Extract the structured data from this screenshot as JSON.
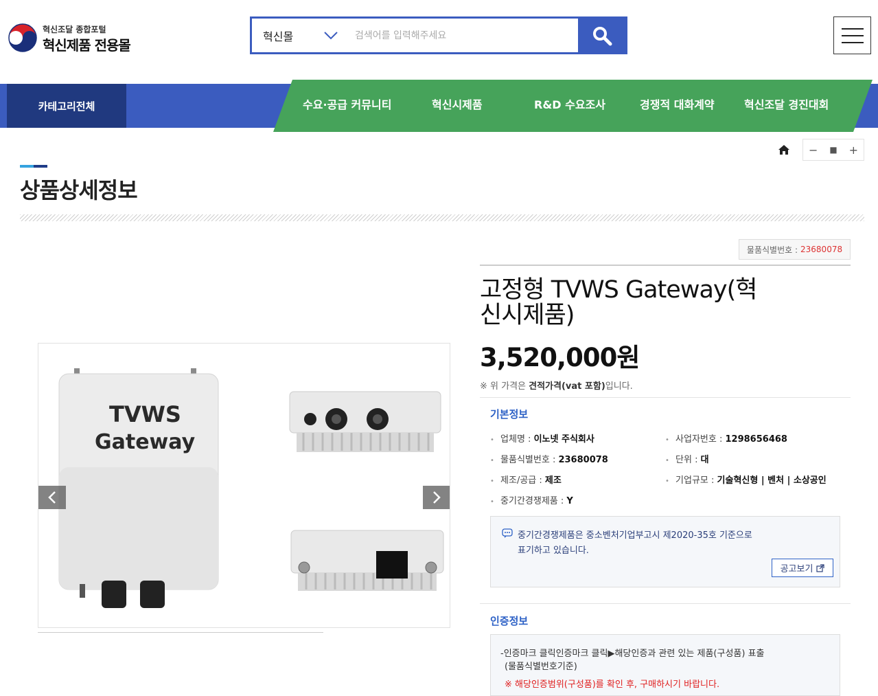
{
  "header": {
    "logo_line1": "혁신조달 종합포털",
    "logo_line2": "혁신제품 전용몰",
    "search": {
      "category": "혁신몰",
      "placeholder": "검색어를 입력해주세요"
    }
  },
  "nav": {
    "all_categories": "카테고리전체",
    "items": [
      "수요·공급 커뮤니티",
      "혁신시제품",
      "R&D 수요조사",
      "경쟁적 대화계약",
      "혁신조달 경진대회"
    ]
  },
  "zoom": {
    "minus": "−",
    "reset": "■",
    "plus": "+"
  },
  "page_title": "상품상세정보",
  "gallery": {
    "main_label_line1": "TVWS",
    "main_label_line2": "Gateway"
  },
  "product": {
    "sku_label": "물품식별번호 :",
    "sku_value": "23680078",
    "name": "고정형 TVWS Gateway(혁신시제품)",
    "price": "3,520,000원",
    "price_note_pre": "※ 위 가격은 ",
    "price_note_bold": "견적가격(vat 포함)",
    "price_note_post": "입니다."
  },
  "basic_info": {
    "title": "기본정보",
    "company_label": "업체명 :",
    "company_value": "이노넷 주식회사",
    "bizno_label": "사업자번호 :",
    "bizno_value": "1298656468",
    "sku_label": "물품식별번호 :",
    "sku_value": "23680078",
    "unit_label": "단위 :",
    "unit_value": "대",
    "supply_label": "제조/공급 :",
    "supply_value": "제조",
    "scale_label": "기업규모 :",
    "scale_value": "기술혁신형 | 벤처 | 소상공인",
    "sme_label": "중기간경쟁제품 :",
    "sme_value": "Y"
  },
  "notice": {
    "line1": "중기간경쟁제품은 중소벤처기업부고시 제2020-35호 기준으로",
    "line2": "표기하고 있습니다.",
    "button": "공고보기"
  },
  "cert_info": {
    "title": "인증정보",
    "line1": "-인증마크 클릭인증마크 클릭▶해당인증과 관련 있는 제품(구성품) 표출",
    "line2": "(물품식별번호기준)",
    "line3": "※ 해당인증범위(구성품)를 확인 후, 구매하시기 바랍니다."
  },
  "colors": {
    "primary_blue": "#3b5cbf",
    "dark_blue": "#20397f",
    "nav_green": "#46a35a",
    "accent_red": "#e02020"
  }
}
